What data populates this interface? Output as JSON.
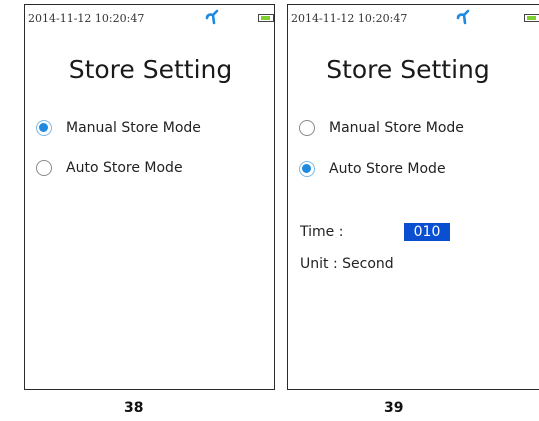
{
  "screens": [
    {
      "status_time": "2014-11-12 10:20:47",
      "title": "Store Setting",
      "options": [
        {
          "label": "Manual Store Mode",
          "selected": true
        },
        {
          "label": "Auto Store Mode",
          "selected": false
        }
      ],
      "caption": "38"
    },
    {
      "status_time": "2014-11-12 10:20:47",
      "title": "Store Setting",
      "options": [
        {
          "label": "Manual Store Mode",
          "selected": false
        },
        {
          "label": "Auto Store Mode",
          "selected": true
        }
      ],
      "time_label": "Time :",
      "time_value": "010",
      "unit_label": "Unit : Second",
      "caption": "39"
    }
  ],
  "colors": {
    "radio_selected": "#1e8ae0",
    "time_value_bg": "#0a4fd1",
    "bluetooth_icon": "#1e8ae0",
    "battery_fill": "#7fcf32"
  },
  "icons": {
    "bluetooth": "bluetooth-icon",
    "battery": "battery-icon"
  }
}
